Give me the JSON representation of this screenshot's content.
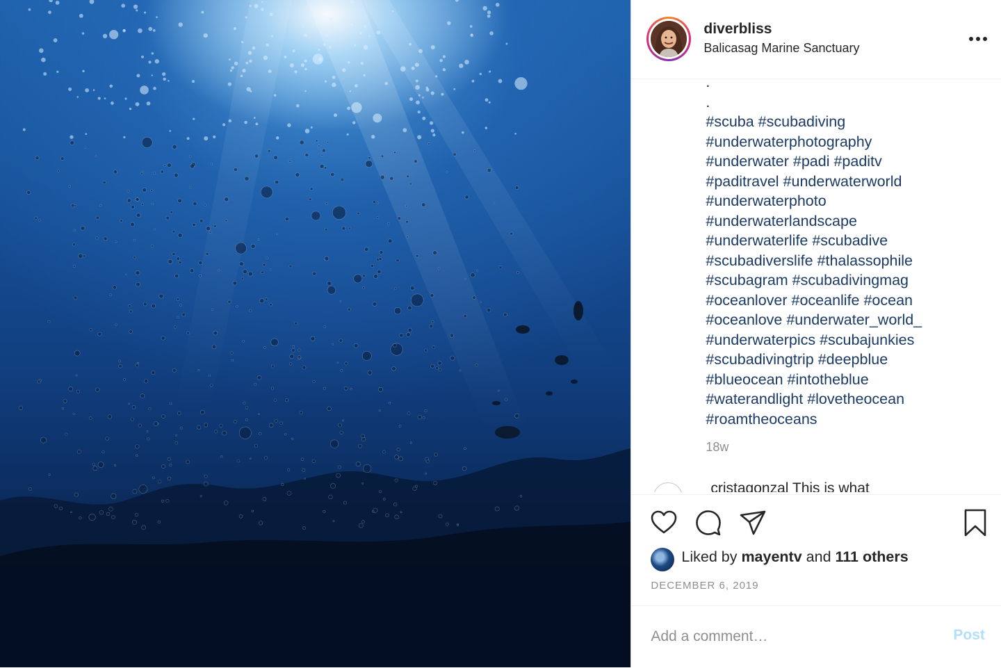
{
  "post": {
    "username": "diverbliss",
    "location": "Balicasag Marine Sanctuary",
    "caption_dots": [
      ".",
      "."
    ],
    "hashtag_lines": [
      "#scuba #scubadiving",
      "#underwaterphotography",
      "#underwater #padi #paditv",
      "#paditravel #underwaterworld",
      "#underwaterphoto",
      "#underwaterlandscape",
      "#underwaterlife #scubadive",
      "#scubadiverslife #thalassophile",
      "#scubagram #scubadivingmag",
      "#oceanlover #oceanlife #ocean",
      "#oceanlove #underwater_world_",
      "#underwaterpics #scubajunkies",
      "#scubadivingtrip #deepblue",
      "#blueocean #intotheblue",
      "#waterandlight #lovetheocean",
      "#roamtheoceans"
    ],
    "age": "18w",
    "partial_comment": "cristagonzal This is what"
  },
  "actions": {
    "like_icon": "heart-icon",
    "comment_icon": "comment-icon",
    "share_icon": "share-icon",
    "save_icon": "bookmark-icon"
  },
  "likes": {
    "prefix": "Liked by ",
    "user": "mayentv",
    "middle": " and ",
    "others": "111 others"
  },
  "date": "DECEMBER 6, 2019",
  "comment_box": {
    "placeholder": "Add a comment…",
    "post_label": "Post"
  },
  "colors": {
    "hashtag": "#1b3a64",
    "text": "#262626",
    "muted": "#8e8e8e",
    "post_disabled": "#b2dffc"
  }
}
